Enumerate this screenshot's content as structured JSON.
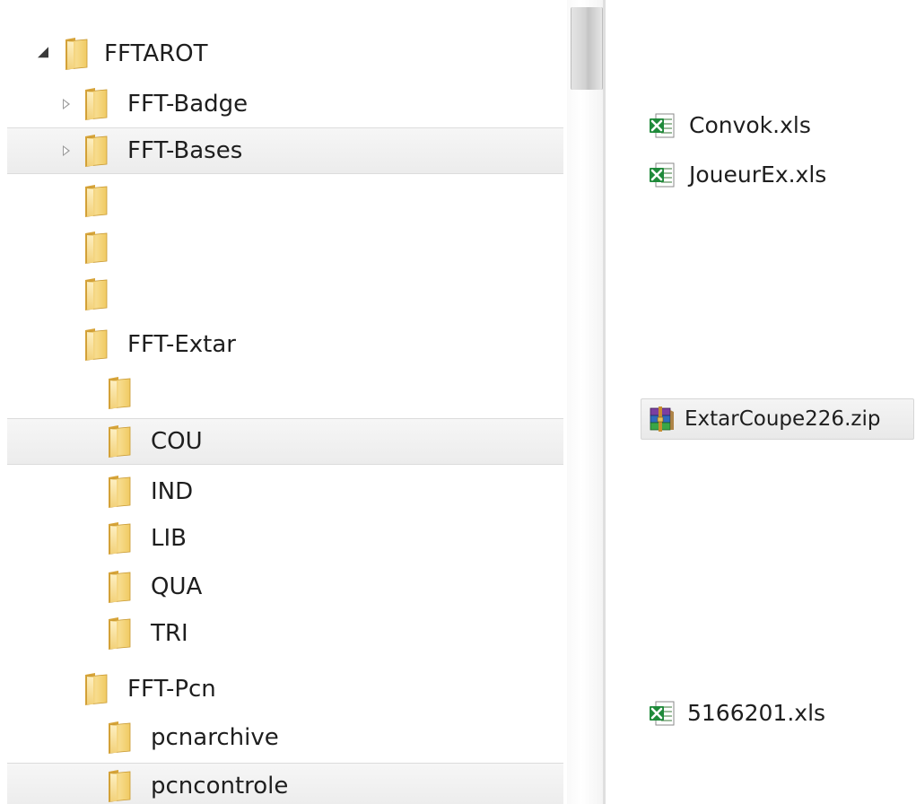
{
  "tree": {
    "items": [
      {
        "label": "FFTAROT",
        "expander": "open"
      },
      {
        "label": "FFT-Badge",
        "expander": "closed"
      },
      {
        "label": "FFT-Bases",
        "expander": "closed"
      },
      {
        "label": "",
        "expander": "none"
      },
      {
        "label": "",
        "expander": "none"
      },
      {
        "label": "",
        "expander": "none"
      },
      {
        "label": "FFT-Extar",
        "expander": "none"
      },
      {
        "label": "",
        "expander": "none"
      },
      {
        "label": "COU",
        "expander": "none"
      },
      {
        "label": "IND",
        "expander": "none"
      },
      {
        "label": "LIB",
        "expander": "none"
      },
      {
        "label": "QUA",
        "expander": "none"
      },
      {
        "label": "TRI",
        "expander": "none"
      },
      {
        "label": "FFT-Pcn",
        "expander": "none"
      },
      {
        "label": "pcnarchive",
        "expander": "none"
      },
      {
        "label": "pcncontrole",
        "expander": "none"
      }
    ]
  },
  "files": {
    "items": [
      {
        "label": "Convok.xls",
        "icon": "excel-file-icon"
      },
      {
        "label": "JoueurEx.xls",
        "icon": "excel-file-icon"
      },
      {
        "label": "ExtarCoupe226.zip",
        "icon": "winrar-archive-icon"
      },
      {
        "label": "5166201.xls",
        "icon": "excel-file-icon"
      }
    ]
  },
  "colors": {
    "folder": "#f2d27a",
    "excel": "#1f8a3a",
    "highlight": "#ececec"
  }
}
